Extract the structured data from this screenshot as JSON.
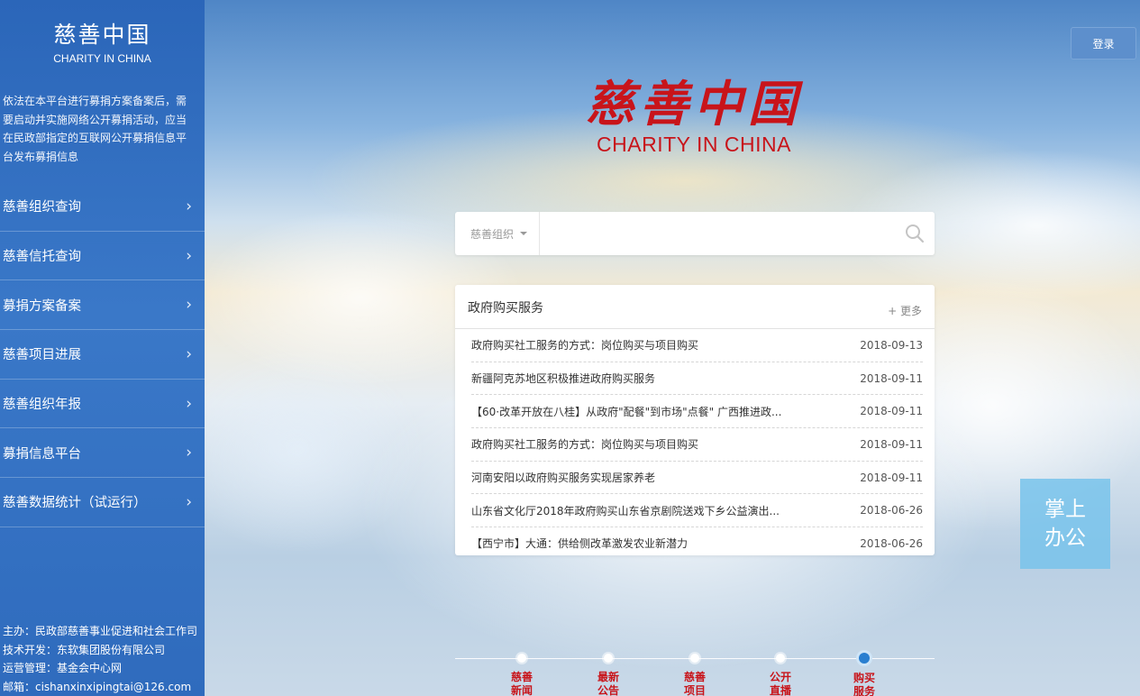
{
  "sidebar": {
    "title_cn": "慈善中国",
    "title_en": "CHARITY IN CHINA",
    "description": "依法在本平台进行募捐方案备案后，需要启动并实施网络公开募捐活动，应当在民政部指定的互联网公开募捐信息平台发布募捐信息",
    "menu": [
      {
        "label": "慈善组织查询",
        "icon": "chevron-right-icon"
      },
      {
        "label": "慈善信托查询",
        "icon": "chevron-right-icon"
      },
      {
        "label": "募捐方案备案",
        "icon": "chevron-right-icon"
      },
      {
        "label": "慈善项目进展",
        "icon": "chevron-right-icon"
      },
      {
        "label": "慈善组织年报",
        "icon": "chevron-right-icon"
      },
      {
        "label": "募捐信息平台",
        "icon": "chevron-right-icon"
      },
      {
        "label": "慈善数据统计（试运行）",
        "icon": "chevron-right-icon"
      }
    ],
    "footer": {
      "host": "主办：民政部慈善事业促进和社会工作司",
      "tech": "技术开发：东软集团股份有限公司",
      "ops": "运营管理：基金会中心网",
      "email": "邮箱：cishanxinxipingtai@126.com"
    }
  },
  "header": {
    "login_label": "登录"
  },
  "brand": {
    "title_cn": "慈善中国",
    "title_en": "CHARITY IN CHINA",
    "color": "#c8141a"
  },
  "search": {
    "category": "慈善组织",
    "value": "",
    "placeholder": ""
  },
  "news": {
    "title": "政府购买服务",
    "more_label": "+ 更多",
    "items": [
      {
        "title": "政府购买社工服务的方式：岗位购买与项目购买",
        "date": "2018-09-13"
      },
      {
        "title": "新疆阿克苏地区积极推进政府购买服务",
        "date": "2018-09-11"
      },
      {
        "title": "【60·改革开放在八桂】从政府\"配餐\"到市场\"点餐\" 广西推进政...",
        "date": "2018-09-11"
      },
      {
        "title": "政府购买社工服务的方式：岗位购买与项目购买",
        "date": "2018-09-11"
      },
      {
        "title": "河南安阳以政府购买服务实现居家养老",
        "date": "2018-09-11"
      },
      {
        "title": "山东省文化厅2018年政府购买山东省京剧院送戏下乡公益演出...",
        "date": "2018-06-26"
      },
      {
        "title": "【西宁市】大通：供给侧改革激发农业新潜力",
        "date": "2018-06-26"
      }
    ]
  },
  "mobile_office": {
    "label_line1": "掌上",
    "label_line2": "办公"
  },
  "timeline": {
    "active_index": 4,
    "items": [
      {
        "label": "慈善新闻"
      },
      {
        "label": "最新公告"
      },
      {
        "label": "慈善项目"
      },
      {
        "label": "公开直播"
      },
      {
        "label": "购买服务"
      }
    ]
  }
}
